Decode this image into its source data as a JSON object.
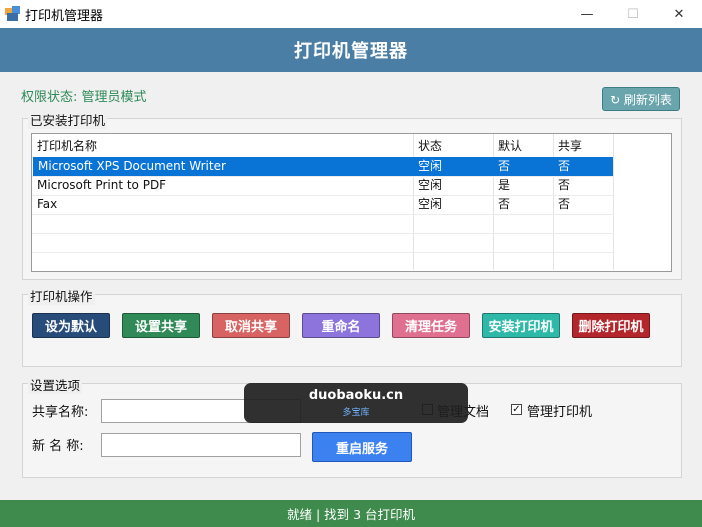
{
  "window": {
    "title": "打印机管理器",
    "minimize_glyph": "—",
    "maximize_glyph": "☐",
    "close_glyph": "✕"
  },
  "header": {
    "title": "打印机管理器"
  },
  "permission_status": "权限状态: 管理员模式",
  "refresh_button": {
    "label": "↻ 刷新列表"
  },
  "installed": {
    "group_label": "已安装打印机",
    "columns": [
      "打印机名称",
      "状态",
      "默认",
      "共享"
    ],
    "rows": [
      [
        "Microsoft XPS Document Writer",
        "空闲",
        "否",
        "否"
      ],
      [
        "Microsoft Print to PDF",
        "空闲",
        "是",
        "否"
      ],
      [
        "Fax",
        "空闲",
        "否",
        "否"
      ]
    ],
    "selected_row": 0
  },
  "operations": {
    "group_label": "打印机操作",
    "buttons": [
      {
        "label": "设为默认",
        "color": "#284c7a"
      },
      {
        "label": "设置共享",
        "color": "#2f8a57"
      },
      {
        "label": "取消共享",
        "color": "#d86363"
      },
      {
        "label": "重命名",
        "color": "#8d74dc"
      },
      {
        "label": "清理任务",
        "color": "#e0708f"
      },
      {
        "label": "安装打印机",
        "color": "#2eb8a8"
      },
      {
        "label": "删除打印机",
        "color": "#b3262c"
      }
    ]
  },
  "settings": {
    "group_label": "设置选项",
    "share_name_label": "共享名称:",
    "share_name_value": "",
    "new_name_label": "新 名 称:",
    "new_name_value": "",
    "check_manage_docs": {
      "label": "管理文档",
      "checked": false
    },
    "check_manage_printer": {
      "label": "管理打印机",
      "checked": true
    },
    "restart_button": "重启服务"
  },
  "watermark": {
    "main": "duobaoku.cn",
    "sub": "多宝库"
  },
  "status_bar": {
    "text": "就绪 | 找到 3 台打印机"
  },
  "colors": {
    "header": "#4a7ea5",
    "status_bar": "#3f8a4d",
    "selection": "#0a74d6"
  }
}
